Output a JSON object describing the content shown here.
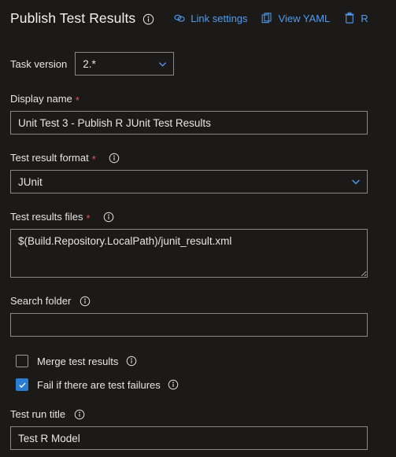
{
  "header": {
    "title": "Publish Test Results",
    "title_info_icon": "info-circle-icon",
    "actions": [
      {
        "label": "Link settings",
        "icon": "link-chain-icon",
        "name": "link-settings-button"
      },
      {
        "label": "View YAML",
        "icon": "clipboard-icon",
        "name": "view-yaml-button"
      },
      {
        "label": "R",
        "icon": "trash-icon",
        "name": "remove-button"
      }
    ],
    "link_color": "#4f9cf0"
  },
  "task_version": {
    "label": "Task version",
    "value": "2.*"
  },
  "fields": {
    "display_name": {
      "label": "Display name",
      "required": true,
      "value": "Unit Test 3 - Publish R JUnit Test Results"
    },
    "test_result_format": {
      "label": "Test result format",
      "required": true,
      "info_icon": "info-circle-icon",
      "value": "JUnit"
    },
    "test_results_files": {
      "label": "Test results files",
      "required": true,
      "info_icon": "info-circle-icon",
      "value": "$(Build.Repository.LocalPath)/junit_result.xml"
    },
    "search_folder": {
      "label": "Search folder",
      "required": false,
      "info_icon": "info-circle-icon",
      "value": ""
    },
    "test_run_title": {
      "label": "Test run title",
      "required": false,
      "info_icon": "info-circle-icon",
      "value": "Test R Model"
    }
  },
  "checkboxes": [
    {
      "label": "Merge test results",
      "checked": false,
      "info_icon": "info-circle-icon",
      "name": "merge-test-results-checkbox"
    },
    {
      "label": "Fail if there are test failures",
      "checked": true,
      "info_icon": "info-circle-icon",
      "name": "fail-if-test-failures-checkbox"
    }
  ],
  "colors": {
    "background": "#1b1a19",
    "text": "#e8e6e3",
    "link": "#4f9cf0",
    "required_asterisk": "#e8545b",
    "border": "#8a8886",
    "checkbox_checked": "#2b7cd3"
  },
  "required_marker": "*"
}
